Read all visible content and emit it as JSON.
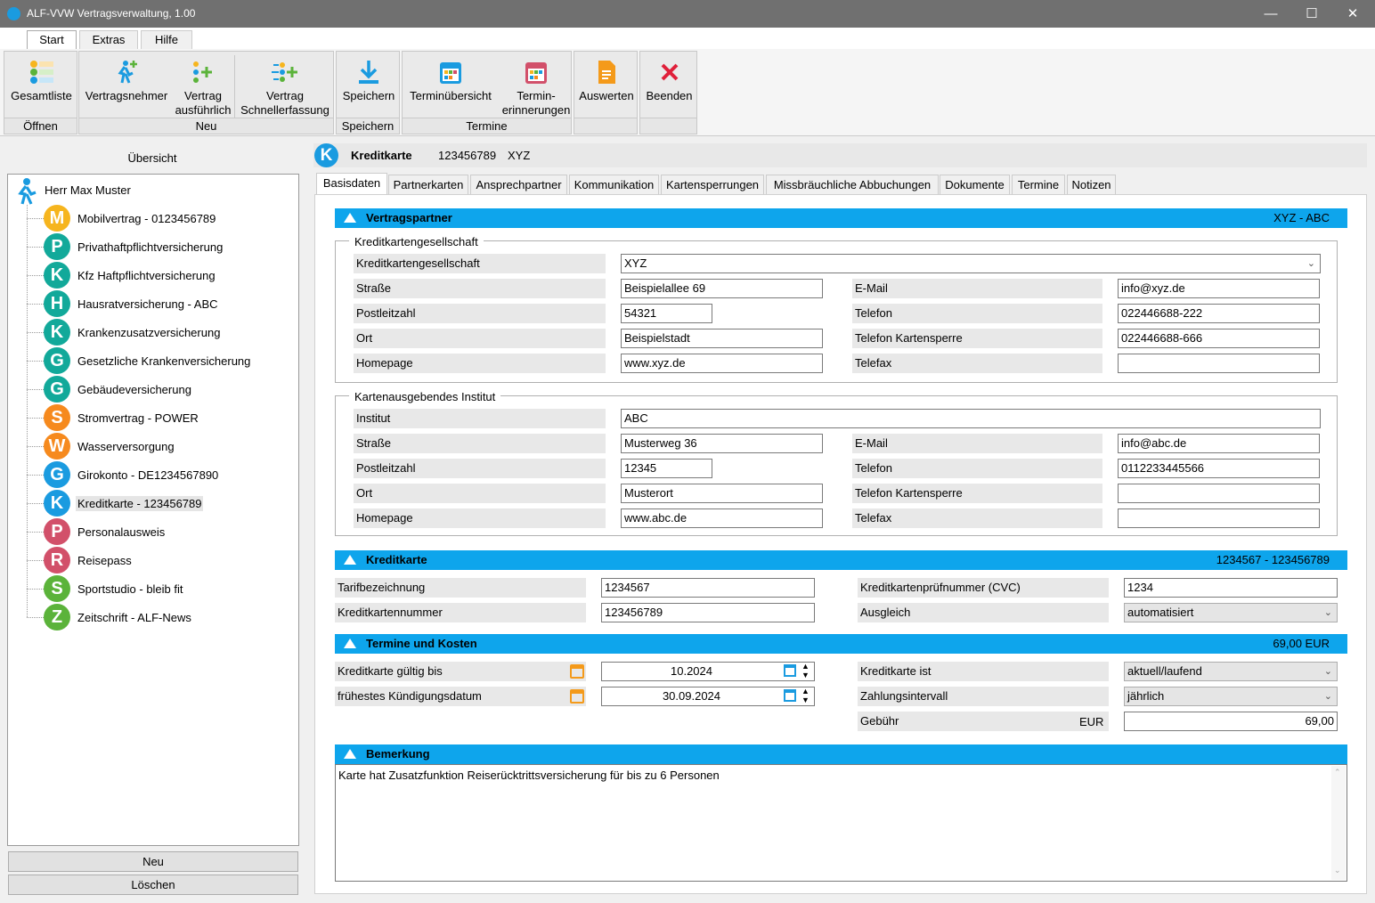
{
  "window": {
    "title": "ALF-VVW Vertragsverwaltung, 1.00",
    "minimize": "—",
    "maximize": "☐",
    "close": "✕"
  },
  "menu_tabs": [
    "Start",
    "Extras",
    "Hilfe"
  ],
  "ribbon": {
    "oeffnen": {
      "label": "Öffnen",
      "gesamtliste": "Gesamtliste"
    },
    "neu": {
      "label": "Neu",
      "vertragsnehmer": "Vertragsnehmer",
      "vertrag_ausfuehrlich_1": "Vertrag",
      "vertrag_ausfuehrlich_2": "ausführlich",
      "schnell_1": "Vertrag",
      "schnell_2": "Schnellerfassung"
    },
    "speichern": {
      "label": "Speichern",
      "btn": "Speichern"
    },
    "termine": {
      "label": "Termine",
      "uebersicht": "Terminübersicht",
      "erinn_1": "Termin-",
      "erinn_2": "erinnerungen"
    },
    "auswerten": "Auswerten",
    "beenden": "Beenden"
  },
  "sidebar": {
    "title": "Übersicht",
    "root": "Herr Max Muster",
    "items": [
      {
        "letter": "M",
        "label": "Mobilvertrag - 0123456789",
        "color": "#f6b51e"
      },
      {
        "letter": "P",
        "label": "Privathaftpflichtversicherung",
        "color": "#12a99a"
      },
      {
        "letter": "K",
        "label": "Kfz Haftpflichtversicherung",
        "color": "#12a99a"
      },
      {
        "letter": "H",
        "label": "Hausratversicherung - ABC",
        "color": "#12a99a"
      },
      {
        "letter": "K",
        "label": "Krankenzusatzversicherung",
        "color": "#12a99a"
      },
      {
        "letter": "G",
        "label": "Gesetzliche Krankenversicherung",
        "color": "#12a99a"
      },
      {
        "letter": "G",
        "label": "Gebäudeversicherung",
        "color": "#12a99a"
      },
      {
        "letter": "S",
        "label": "Stromvertrag - POWER",
        "color": "#f68a1e"
      },
      {
        "letter": "W",
        "label": "Wasserversorgung",
        "color": "#f68a1e"
      },
      {
        "letter": "G",
        "label": "Girokonto - DE1234567890",
        "color": "#1a9be0"
      },
      {
        "letter": "K",
        "label": "Kreditkarte - 123456789",
        "color": "#1a9be0"
      },
      {
        "letter": "P",
        "label": "Personalausweis",
        "color": "#d2506a"
      },
      {
        "letter": "R",
        "label": "Reisepass",
        "color": "#d2506a"
      },
      {
        "letter": "S",
        "label": "Sportstudio - bleib fit",
        "color": "#5bb33a"
      },
      {
        "letter": "Z",
        "label": "Zeitschrift - ALF-News",
        "color": "#5bb33a"
      }
    ],
    "new_button": "Neu",
    "delete_button": "Löschen"
  },
  "header": {
    "letter": "K",
    "type": "Kreditkarte",
    "number": "123456789",
    "institute": "XYZ"
  },
  "tabs": [
    "Basisdaten",
    "Partnerkarten",
    "Ansprechpartner",
    "Kommunikation",
    "Kartensperrungen",
    "Missbräuchliche Abbuchungen",
    "Dokumente",
    "Termine",
    "Notizen"
  ],
  "vertragspartner": {
    "title": "Vertragspartner",
    "summary": "XYZ - ABC",
    "gesellschaft": {
      "group": "Kreditkartengesellschaft",
      "label_name": "Kreditkartengesellschaft",
      "name": "XYZ",
      "label_strasse": "Straße",
      "strasse": "Beispielallee 69",
      "label_plz": "Postleitzahl",
      "plz": "54321",
      "label_ort": "Ort",
      "ort": "Beispielstadt",
      "label_homepage": "Homepage",
      "homepage": "www.xyz.de",
      "label_email": "E-Mail",
      "email": "info@xyz.de",
      "label_telefon": "Telefon",
      "telefon": "022446688-222",
      "label_sperre": "Telefon Kartensperre",
      "sperre": "022446688-666",
      "label_telefax": "Telefax",
      "telefax": ""
    },
    "institut": {
      "group": "Kartenausgebendes Institut",
      "label_name": "Institut",
      "name": "ABC",
      "label_strasse": "Straße",
      "strasse": "Musterweg 36",
      "label_plz": "Postleitzahl",
      "plz": "12345",
      "label_ort": "Ort",
      "ort": "Musterort",
      "label_homepage": "Homepage",
      "homepage": "www.abc.de",
      "label_email": "E-Mail",
      "email": "info@abc.de",
      "label_telefon": "Telefon",
      "telefon": "0112233445566",
      "label_sperre": "Telefon Kartensperre",
      "sperre": "",
      "label_telefax": "Telefax",
      "telefax": ""
    }
  },
  "kreditkarte": {
    "title": "Kreditkarte",
    "summary": "1234567 - 123456789",
    "label_tarif": "Tarifbezeichnung",
    "tarif": "1234567",
    "label_nummer": "Kreditkartennummer",
    "nummer": "123456789",
    "label_cvc": "Kreditkartenprüfnummer (CVC)",
    "cvc": "1234",
    "label_ausgleich": "Ausgleich",
    "ausgleich": "automatisiert"
  },
  "termine": {
    "title": "Termine und Kosten",
    "summary": "69,00 EUR",
    "label_gueltig": "Kreditkarte gültig bis",
    "gueltig": "10.2024",
    "label_kuendigung": "frühestes Kündigungsdatum",
    "kuendigung": "30.09.2024",
    "label_status": "Kreditkarte ist",
    "status": "aktuell/laufend",
    "label_intervall": "Zahlungsintervall",
    "intervall": "jährlich",
    "label_gebuehr": "Gebühr",
    "currency": "EUR",
    "gebuehr": "69,00"
  },
  "bemerkung": {
    "title": "Bemerkung",
    "text": "Karte hat Zusatzfunktion Reiserücktrittsversicherung für bis zu 6 Personen"
  }
}
